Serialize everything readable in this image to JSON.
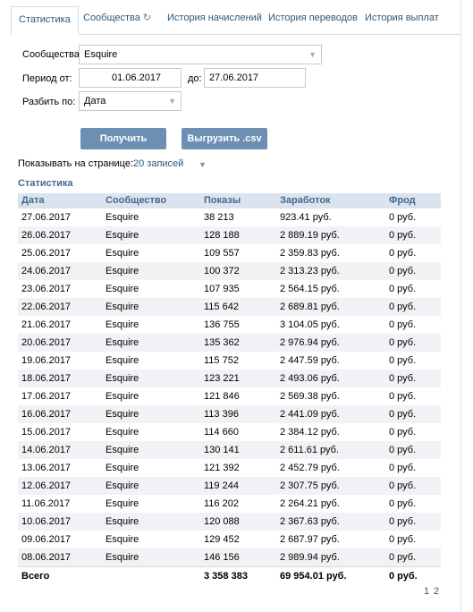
{
  "tabs": [
    {
      "label": "Статистика"
    },
    {
      "label": "Сообщества"
    },
    {
      "label": "История начислений"
    },
    {
      "label": "История переводов"
    },
    {
      "label": "История выплат"
    }
  ],
  "refresh_glyph": "↻",
  "form": {
    "community_label": "Сообщества:",
    "community_value": "Esquire",
    "period_from_label": "Период от:",
    "period_from_value": "01.06.2017",
    "period_to_label": "до:",
    "period_to_value": "27.06.2017",
    "split_label": "Разбить по:",
    "split_value": "Дата",
    "get_data_button": "Получить данные",
    "export_button": "Выгрузить .csv",
    "per_page_label": "Показывать на странице:",
    "per_page_value": "20 записей"
  },
  "section_title": "Статистика",
  "table": {
    "headers": [
      "Дата",
      "Сообщество",
      "Показы",
      "Заработок",
      "Фрод"
    ],
    "rows": [
      [
        "27.06.2017",
        "Esquire",
        "38 213",
        "923.41 руб.",
        "0 руб."
      ],
      [
        "26.06.2017",
        "Esquire",
        "128 188",
        "2 889.19 руб.",
        "0 руб."
      ],
      [
        "25.06.2017",
        "Esquire",
        "109 557",
        "2 359.83 руб.",
        "0 руб."
      ],
      [
        "24.06.2017",
        "Esquire",
        "100 372",
        "2 313.23 руб.",
        "0 руб."
      ],
      [
        "23.06.2017",
        "Esquire",
        "107 935",
        "2 564.15 руб.",
        "0 руб."
      ],
      [
        "22.06.2017",
        "Esquire",
        "115 642",
        "2 689.81 руб.",
        "0 руб."
      ],
      [
        "21.06.2017",
        "Esquire",
        "136 755",
        "3 104.05 руб.",
        "0 руб."
      ],
      [
        "20.06.2017",
        "Esquire",
        "135 362",
        "2 976.94 руб.",
        "0 руб."
      ],
      [
        "19.06.2017",
        "Esquire",
        "115 752",
        "2 447.59 руб.",
        "0 руб."
      ],
      [
        "18.06.2017",
        "Esquire",
        "123 221",
        "2 493.06 руб.",
        "0 руб."
      ],
      [
        "17.06.2017",
        "Esquire",
        "121 846",
        "2 569.38 руб.",
        "0 руб."
      ],
      [
        "16.06.2017",
        "Esquire",
        "113 396",
        "2 441.09 руб.",
        "0 руб."
      ],
      [
        "15.06.2017",
        "Esquire",
        "114 660",
        "2 384.12 руб.",
        "0 руб."
      ],
      [
        "14.06.2017",
        "Esquire",
        "130 141",
        "2 611.61 руб.",
        "0 руб."
      ],
      [
        "13.06.2017",
        "Esquire",
        "121 392",
        "2 452.79 руб.",
        "0 руб."
      ],
      [
        "12.06.2017",
        "Esquire",
        "119 244",
        "2 307.75 руб.",
        "0 руб."
      ],
      [
        "11.06.2017",
        "Esquire",
        "116 202",
        "2 264.21 руб.",
        "0 руб."
      ],
      [
        "10.06.2017",
        "Esquire",
        "120 088",
        "2 367.63 руб.",
        "0 руб."
      ],
      [
        "09.06.2017",
        "Esquire",
        "129 452",
        "2 687.97 руб.",
        "0 руб."
      ],
      [
        "08.06.2017",
        "Esquire",
        "146 156",
        "2 989.94 руб.",
        "0 руб."
      ]
    ],
    "total": [
      "Всего",
      "",
      "3 358 383",
      "69 954.01 руб.",
      "0 руб."
    ]
  },
  "pagination": {
    "pages": [
      "1",
      "2"
    ],
    "current": "1"
  },
  "colors": {
    "accent": "#2b587a",
    "header_bg": "#dbe4ee",
    "button": "#6d8fb3"
  }
}
